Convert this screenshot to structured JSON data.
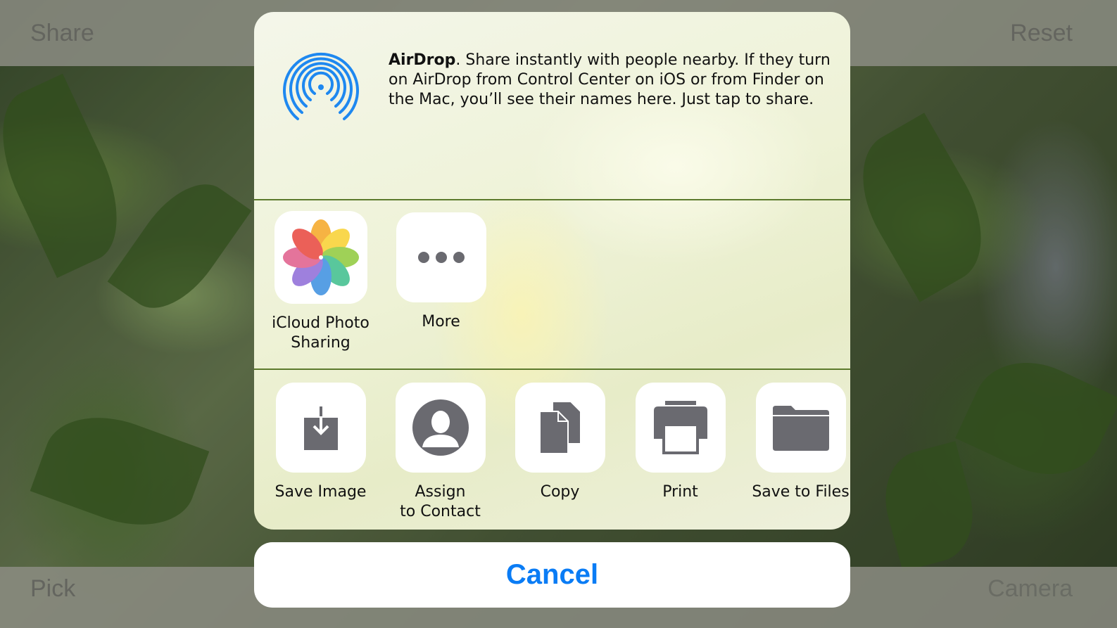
{
  "toolbar": {
    "share_label": "Share",
    "reset_label": "Reset",
    "pick_label": "Pick",
    "camera_label": "Camera"
  },
  "share_sheet": {
    "airdrop": {
      "icon": "airdrop-icon",
      "title": "AirDrop",
      "text": ". Share instantly with people nearby. If they turn on AirDrop from Control Center on iOS or from Finder on the Mac, you’ll see their names here. Just tap to share."
    },
    "apps": [
      {
        "label": "iCloud Photo\nSharing",
        "icon": "photos-icon"
      },
      {
        "label": "More",
        "icon": "more-icon"
      }
    ],
    "actions": [
      {
        "label": "Save Image",
        "icon": "save-image-icon"
      },
      {
        "label": "Assign\nto Contact",
        "icon": "contact-icon"
      },
      {
        "label": "Copy",
        "icon": "copy-icon"
      },
      {
        "label": "Print",
        "icon": "print-icon"
      },
      {
        "label": "Save to Files",
        "icon": "folder-icon"
      }
    ],
    "cancel_label": "Cancel"
  },
  "colors": {
    "accent": "#0A7CF5",
    "airdrop_blue": "#1E88F0",
    "glyph_gray": "#6A6A70"
  }
}
